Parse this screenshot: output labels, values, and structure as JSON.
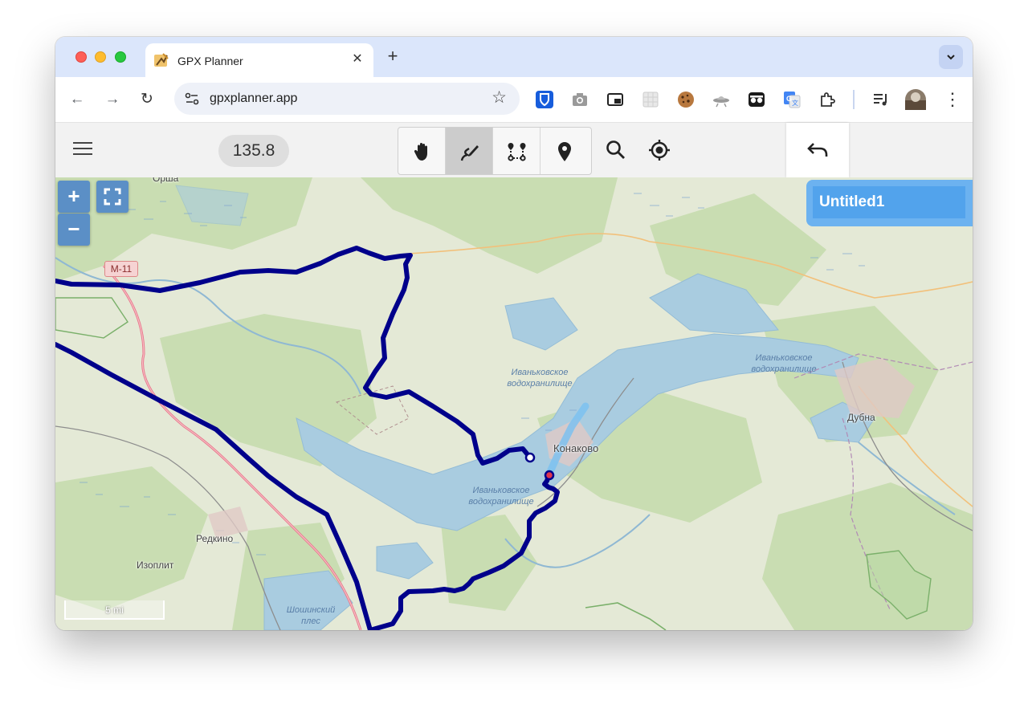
{
  "browser": {
    "tab_title": "GPX Planner",
    "tab_close": "✕",
    "new_tab": "+",
    "tab_menu": "⌄",
    "url": "gpxplanner.app",
    "back": "←",
    "forward": "→",
    "reload": "↻",
    "star": "☆",
    "menu_dots": "⋮"
  },
  "app": {
    "distance": "135.8",
    "modes": [
      {
        "name": "pan",
        "icon": "hand-icon",
        "active": false
      },
      {
        "name": "draw",
        "icon": "draw-route-icon",
        "active": true
      },
      {
        "name": "waypoint-route",
        "icon": "route-points-icon",
        "active": false
      },
      {
        "name": "marker",
        "icon": "map-pin-icon",
        "active": false
      }
    ],
    "track_title": "Untitled1"
  },
  "map": {
    "zoom_in": "+",
    "zoom_out": "−",
    "scale": "5 mi",
    "road_ref": "M-11",
    "places": {
      "orsha": "Орша",
      "konakovo": "Конаково",
      "dubna": "Дубна",
      "redkino": "Редкино",
      "izoplit": "Изоплит"
    },
    "water": {
      "ivankovo_1": "Иваньковское водохранилище",
      "ivankovo_2": "Иваньковское водохранилище",
      "ivankovo_3": "Иваньковское водохранилище",
      "shoshinsky": "Шошинский плес"
    },
    "colors": {
      "route": "#00008b",
      "active_segment": "#7cc1f0",
      "water": "#a9cce0",
      "forest": "#c7dcae",
      "land": "#e6ead9",
      "primary_road": "#e8758a"
    }
  }
}
